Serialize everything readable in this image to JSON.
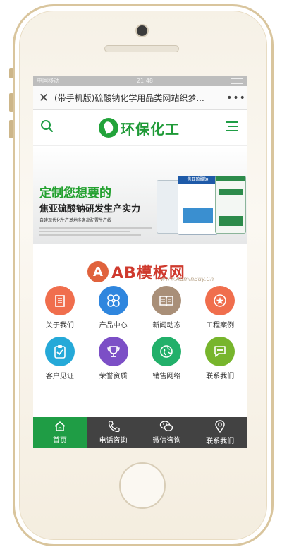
{
  "status": {
    "left": "中国移动",
    "time": "21:48"
  },
  "browser": {
    "title": "(带手机版)硫酸钠化学用品类网站织梦...",
    "close_icon": "close-icon",
    "more_icon": "more-icon"
  },
  "header": {
    "logo_text": "环保化工",
    "search_icon": "search-icon",
    "menu_icon": "menu-icon"
  },
  "banner": {
    "headline": "定制您想要的",
    "subheadline": "焦亚硫酸钠研发生产实力",
    "tagline": "自建现代化生产基地多条高配置生产线",
    "product_label": "焦亚硫酸钠"
  },
  "watermark": {
    "badge": "A",
    "text": "AB模板网",
    "url": "www.AdminBuy.Cn"
  },
  "nav_grid": [
    {
      "label": "关于我们",
      "icon": "building-icon",
      "color": "#f06e4d"
    },
    {
      "label": "产品中心",
      "icon": "clover-icon",
      "color": "#2f86de"
    },
    {
      "label": "新闻动态",
      "icon": "book-icon",
      "color": "#a98f78"
    },
    {
      "label": "工程案例",
      "icon": "star-badge-icon",
      "color": "#f06e4d"
    },
    {
      "label": "客户见证",
      "icon": "clipboard-check-icon",
      "color": "#25a9d8"
    },
    {
      "label": "荣誉资质",
      "icon": "trophy-icon",
      "color": "#7c4fc6"
    },
    {
      "label": "销售网络",
      "icon": "globe-icon",
      "color": "#22b06a"
    },
    {
      "label": "联系我们",
      "icon": "chat-icon",
      "color": "#77b52c"
    }
  ],
  "tabbar": [
    {
      "label": "首页",
      "icon": "home-icon",
      "active": true
    },
    {
      "label": "电话咨询",
      "icon": "phone-icon",
      "active": false
    },
    {
      "label": "微信咨询",
      "icon": "wechat-icon",
      "active": false
    },
    {
      "label": "联系我们",
      "icon": "location-pin-icon",
      "active": false
    }
  ],
  "colors": {
    "brand_green": "#1f9d45",
    "tabbar_bg": "#424242"
  }
}
